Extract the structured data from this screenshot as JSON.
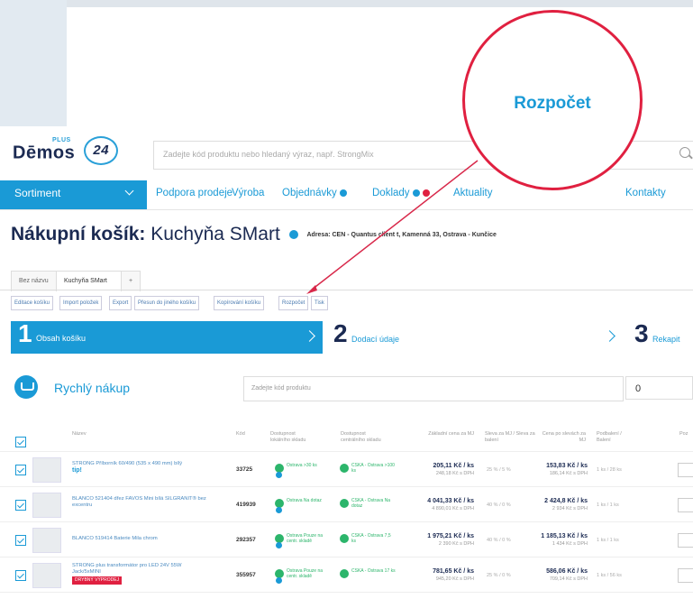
{
  "header": {
    "logo_text": "Dēmos",
    "logo_badge": "24",
    "logo_plus": "PLUS",
    "search_placeholder": "Zadejte kód produktu nebo hledaný výraz, např. StrongMix"
  },
  "nav": {
    "sortiment": "Sortiment",
    "items": [
      "Podpora prodeje",
      "Výroba",
      "Objednávky",
      "Doklady",
      "Aktuality",
      "Kontakty"
    ]
  },
  "page": {
    "title_bold": "Nákupní košík:",
    "title_rest": "Kuchyňa SMart",
    "address": "Adresa: CEN - Quantus client t, Kamenná 33, Ostrava - Kunčice"
  },
  "tabs": [
    "Bez názvu",
    "Kuchyňa SMart",
    "+"
  ],
  "actions": [
    "Editace košíku",
    "Import položek",
    "Export",
    "Přesun do jiného košíku",
    "Kopírování košíku",
    "Rozpočet",
    "Tisk"
  ],
  "steps": [
    {
      "num": "1",
      "label": "Obsah košíku"
    },
    {
      "num": "2",
      "label": "Dodací údaje"
    },
    {
      "num": "3",
      "label": "Rekapit"
    }
  ],
  "quick_buy": {
    "title": "Rychlý nákup",
    "placeholder": "Zadejte kód produktu",
    "qty": "0"
  },
  "table": {
    "headers": [
      "Název",
      "Kód",
      "Dostupnost lokálního skladu",
      "Dostupnost centrálního skladu",
      "Základní cena za MJ",
      "Sleva za MJ / Sleva za balení",
      "Cena po slevách za MJ",
      "Podbalení / Balení",
      "Poz"
    ],
    "rows": [
      {
        "name": "STRONG Příborník 60/490 (535 x 490 mm) bílý",
        "tag_text": "tip!",
        "red_tag": "",
        "code": "33725",
        "local": "Ostrava >30 ks",
        "central": "CSKA - Ostrava >100 ks",
        "base": "205,11 Kč / ks",
        "base_sub": "248,18 Kč s DPH",
        "disc": "25 % / 5 %",
        "final": "153,83 Kč / ks",
        "final_sub": "186,14 Kč s DPH",
        "pack": "1 ks / 28 ks"
      },
      {
        "name": "BLANCO 521404 dřez FAVOS Mini bílá SILGRANIT® bez excentru",
        "tag_text": "",
        "red_tag": "",
        "code": "419939",
        "local": "Ostrava Na dotaz",
        "central": "CSKA - Ostrava Na dotaz",
        "base": "4 041,33 Kč / ks",
        "base_sub": "4 890,01 Kč s DPH",
        "disc": "40 % / 0 %",
        "final": "2 424,8 Kč / ks",
        "final_sub": "2 934 Kč s DPH",
        "pack": "1 ks / 1 ks"
      },
      {
        "name": "BLANCO 519414 Baterie Mila chrom",
        "tag_text": "",
        "red_tag": "",
        "code": "292357",
        "local": "Ostrava Pouze na centr. skladě",
        "central": "CSKA - Ostrava 7,5 ks",
        "base": "1 975,21 Kč / ks",
        "base_sub": "2 390 Kč s DPH",
        "disc": "40 % / 0 %",
        "final": "1 185,13 Kč / ks",
        "final_sub": "1 434 Kč s DPH",
        "pack": "1 ks / 1 ks"
      },
      {
        "name": "STRONG plus transformátor pro LED 24V 55W Jack/5xMINI",
        "tag_text": "",
        "red_tag": "DRYBNÝ VÝPRODEJ",
        "code": "355957",
        "local": "Ostrava Pouze na centr. skladě",
        "central": "CSKA - Ostrava 17 ks",
        "base": "781,65 Kč / ks",
        "base_sub": "945,20 Kč s DPH",
        "disc": "25 % / 0 %",
        "final": "586,06 Kč / ks",
        "final_sub": "709,14 Kč s DPH",
        "pack": "1 ks / 56 ks"
      }
    ]
  },
  "callout": {
    "label": "Rozpočet",
    "border_color": "#e02040",
    "text_color": "#1a9ad6"
  },
  "colors": {
    "accent": "#1a9ad6",
    "navy": "#1b2a52",
    "red": "#e02040",
    "green": "#2cb56b"
  }
}
